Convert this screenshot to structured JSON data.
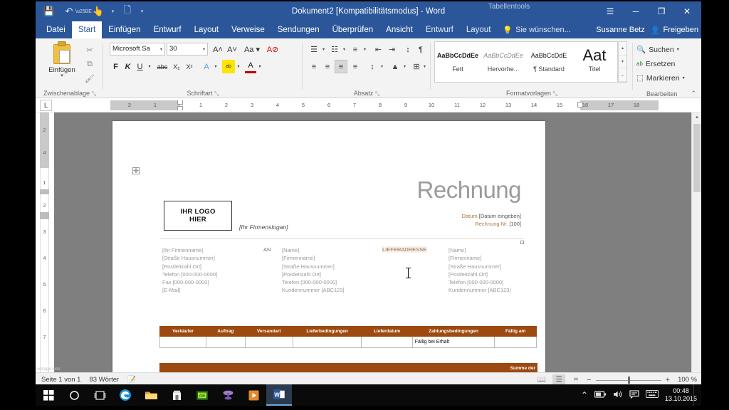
{
  "window": {
    "title": "Dokument2 [Kompatibilitätsmodus] - Word",
    "contextual_tools": "Tabellentools",
    "quick_access": [
      {
        "name": "save-icon",
        "glyph": "💾"
      },
      {
        "name": "undo-icon",
        "glyph": "↶"
      },
      {
        "name": "touch-mode-icon",
        "glyph": "👆"
      },
      {
        "name": "new-document-icon",
        "glyph": "🗋"
      },
      {
        "name": "customize-qat-icon",
        "glyph": "▾"
      }
    ],
    "controls": [
      {
        "name": "ribbon-display-options-icon",
        "glyph": "☰"
      },
      {
        "name": "minimize-icon",
        "glyph": "─"
      },
      {
        "name": "restore-icon",
        "glyph": "❐"
      },
      {
        "name": "close-icon",
        "glyph": "✕"
      }
    ]
  },
  "tabs": [
    {
      "label": "Datei",
      "active": false
    },
    {
      "label": "Start",
      "active": true
    },
    {
      "label": "Einfügen",
      "active": false
    },
    {
      "label": "Entwurf",
      "active": false
    },
    {
      "label": "Layout",
      "active": false
    },
    {
      "label": "Verweise",
      "active": false
    },
    {
      "label": "Sendungen",
      "active": false
    },
    {
      "label": "Überprüfen",
      "active": false
    },
    {
      "label": "Ansicht",
      "active": false
    },
    {
      "label": "Entwurf",
      "active": false
    },
    {
      "label": "Layout",
      "active": false
    }
  ],
  "tell_me": "Sie wünschen...",
  "account_name": "Susanne Betz",
  "share_label": "Freigeben",
  "ribbon": {
    "clipboard": {
      "group_label": "Zwischenablage",
      "paste_label": "Einfügen",
      "paste_caret": "▾",
      "tools": [
        {
          "name": "cut-icon",
          "glyph": "✂"
        },
        {
          "name": "copy-icon",
          "glyph": "⧉"
        },
        {
          "name": "format-painter-icon",
          "glyph": "🖌"
        }
      ]
    },
    "font": {
      "group_label": "Schriftart",
      "font_name_value": "Microsoft Sa",
      "font_size_value": "30",
      "row1": [
        {
          "name": "grow-font-icon",
          "label": "A˄"
        },
        {
          "name": "shrink-font-icon",
          "label": "A˅"
        },
        {
          "name": "change-case-icon",
          "label": "Aa ▾"
        },
        {
          "name": "clear-formatting-icon",
          "label": "A⊘"
        }
      ],
      "row2": [
        {
          "name": "bold-button",
          "label": "F"
        },
        {
          "name": "italic-button",
          "label": "K"
        },
        {
          "name": "underline-button",
          "label": "U"
        },
        {
          "name": "underline-caret",
          "label": "▾"
        },
        {
          "name": "strikethrough-button",
          "label": "abc"
        },
        {
          "name": "subscript-button",
          "label": "X₂"
        },
        {
          "name": "superscript-button",
          "label": "X²"
        },
        {
          "name": "text-effects-button",
          "label": "A"
        },
        {
          "name": "text-effects-caret",
          "label": "▾"
        },
        {
          "name": "highlight-button",
          "label": "ab"
        },
        {
          "name": "highlight-caret",
          "label": "▾"
        },
        {
          "name": "font-color-button",
          "label": "A"
        },
        {
          "name": "font-color-caret",
          "label": "▾"
        }
      ]
    },
    "paragraph": {
      "group_label": "Absatz",
      "row1": [
        {
          "name": "bullets-button",
          "label": "☰"
        },
        {
          "name": "bullets-caret",
          "label": "▾"
        },
        {
          "name": "numbering-button",
          "label": "☷"
        },
        {
          "name": "numbering-caret",
          "label": "▾"
        },
        {
          "name": "multilevel-list-button",
          "label": "≡"
        },
        {
          "name": "multilevel-caret",
          "label": "▾"
        },
        {
          "name": "decrease-indent-button",
          "label": "⇤"
        },
        {
          "name": "increase-indent-button",
          "label": "⇥"
        },
        {
          "name": "sort-button",
          "label": "↕"
        },
        {
          "name": "show-marks-button",
          "label": "¶"
        }
      ],
      "row2": [
        {
          "name": "align-left-button",
          "label": "≡"
        },
        {
          "name": "align-center-button",
          "label": "≡"
        },
        {
          "name": "align-right-button",
          "label": "≡"
        },
        {
          "name": "justify-button",
          "label": "≡"
        },
        {
          "name": "line-spacing-button",
          "label": "↕"
        },
        {
          "name": "line-spacing-caret",
          "label": "▾"
        },
        {
          "name": "shading-button",
          "label": "▲"
        },
        {
          "name": "shading-caret",
          "label": "▾"
        },
        {
          "name": "borders-button",
          "label": "⊞"
        },
        {
          "name": "borders-caret",
          "label": "▾"
        }
      ]
    },
    "styles": {
      "group_label": "Formatvorlagen",
      "items": [
        {
          "preview": "AaBbCcDdEe",
          "name": "Fett"
        },
        {
          "preview": "AaBbCcDdEe",
          "name": "Hervorhe..."
        },
        {
          "preview": "AaBbCcDdE",
          "name": "¶ Standard"
        },
        {
          "preview": "Aat",
          "name": "Titel"
        }
      ],
      "scroll": [
        "▴",
        "▾",
        "⌄"
      ]
    },
    "editing": {
      "group_label": "Bearbeiten",
      "items": [
        {
          "name": "find-button",
          "icon": "🔍",
          "label": "Suchen",
          "caret": "▾"
        },
        {
          "name": "replace-button",
          "icon": "ab",
          "label": "Ersetzen",
          "caret": ""
        },
        {
          "name": "select-button",
          "icon": "⬚",
          "label": "Markieren",
          "caret": "▾"
        }
      ]
    },
    "collapse_glyph": "⌃",
    "dialog_glyph": "⤡"
  },
  "ruler": {
    "tab_selector": "L",
    "h_ticks": [
      "2",
      "1",
      "1",
      "2",
      "3",
      "4",
      "5",
      "6",
      "7",
      "8",
      "9",
      "10",
      "11",
      "12",
      "13",
      "14",
      "15",
      "16",
      "17",
      "18"
    ],
    "v_ticks": [
      "2",
      "4",
      "1",
      "2",
      "3",
      "4",
      "5",
      "6",
      "7"
    ]
  },
  "document": {
    "table_handle": "✛",
    "logo_line1": "IHR LOGO",
    "logo_line2": "HIER",
    "slogan": "[Ihr Firmenslogan]",
    "title": "Rechnung",
    "meta": [
      {
        "label": "Datum",
        "value": "[Datum eingeben]"
      },
      {
        "label": "Rechnung Nr.",
        "value": "[100]"
      }
    ],
    "from_address": [
      "[Ihr Firmenname]",
      "[Straße Hausnummer]",
      "[Postleitzahl Ort]",
      "Telefon [000-000-0000]",
      "Fax [000-000-0000]",
      "[E-Mail]"
    ],
    "an_label": "AN",
    "to_address": [
      "[Name]",
      "[Firmenname]",
      "[Straße Hausnummer]",
      "[Postleitzahl Ort]",
      "Telefon [000-000-0000]",
      "Kundennummer [ABC123]"
    ],
    "ship_label": "LIEFERADRESSE",
    "ship_address": [
      "[Name]",
      "[Firmenname]",
      "[Straße Hausnummer]",
      "[Postleitzahl Ort]",
      "Telefon [000-000-0000]",
      "Kundennummer [ABC123]"
    ],
    "table": {
      "headers": [
        "Verkäufer",
        "Auftrag",
        "Versandart",
        "Lieferbedingungen",
        "Lieferdatum",
        "Zahlungsbedingungen",
        "Fällig am"
      ],
      "rows": [
        [
          "",
          "",
          "",
          "",
          "",
          "Fällig bei Erhalt",
          ""
        ]
      ]
    },
    "table2": {
      "headers": [
        "",
        "",
        "",
        "",
        "Summe der"
      ]
    },
    "accent_color": "#9c4a10"
  },
  "status_bar": {
    "page_info": "Seite 1 von 1",
    "word_count": "83 Wörter",
    "proofing_icon": "📝",
    "views": [
      {
        "name": "read-mode-button",
        "glyph": "📖",
        "active": false
      },
      {
        "name": "print-layout-button",
        "glyph": "☰",
        "active": true
      },
      {
        "name": "web-layout-button",
        "glyph": "⌗",
        "active": false
      }
    ],
    "zoom_out": "−",
    "zoom_in": "+",
    "zoom_level": "100 %"
  },
  "web_overlay": "vorlage\nweb",
  "taskbar": {
    "items": [
      {
        "name": "start-button",
        "glyph": "⊞"
      },
      {
        "name": "cortana-search-icon",
        "glyph": "○"
      },
      {
        "name": "task-view-icon",
        "glyph": "❐"
      },
      {
        "name": "edge-icon",
        "glyph": "e"
      },
      {
        "name": "file-explorer-icon",
        "glyph": "📁"
      },
      {
        "name": "store-icon",
        "glyph": "🛍"
      },
      {
        "name": "camtasia-icon",
        "glyph": "■"
      },
      {
        "name": "media-app-icon",
        "glyph": "☂"
      },
      {
        "name": "player-icon",
        "glyph": "▶"
      },
      {
        "name": "word-taskbar-icon",
        "glyph": "W"
      }
    ],
    "tray": [
      {
        "name": "show-hidden-icons-icon",
        "glyph": "⌃"
      },
      {
        "name": "battery-icon",
        "glyph": "🔋"
      },
      {
        "name": "volume-icon",
        "glyph": "🔊"
      },
      {
        "name": "action-center-icon",
        "glyph": "💬"
      },
      {
        "name": "keyboard-icon",
        "glyph": "⌨"
      }
    ],
    "time": "00:48",
    "date": "13.10.2015"
  }
}
